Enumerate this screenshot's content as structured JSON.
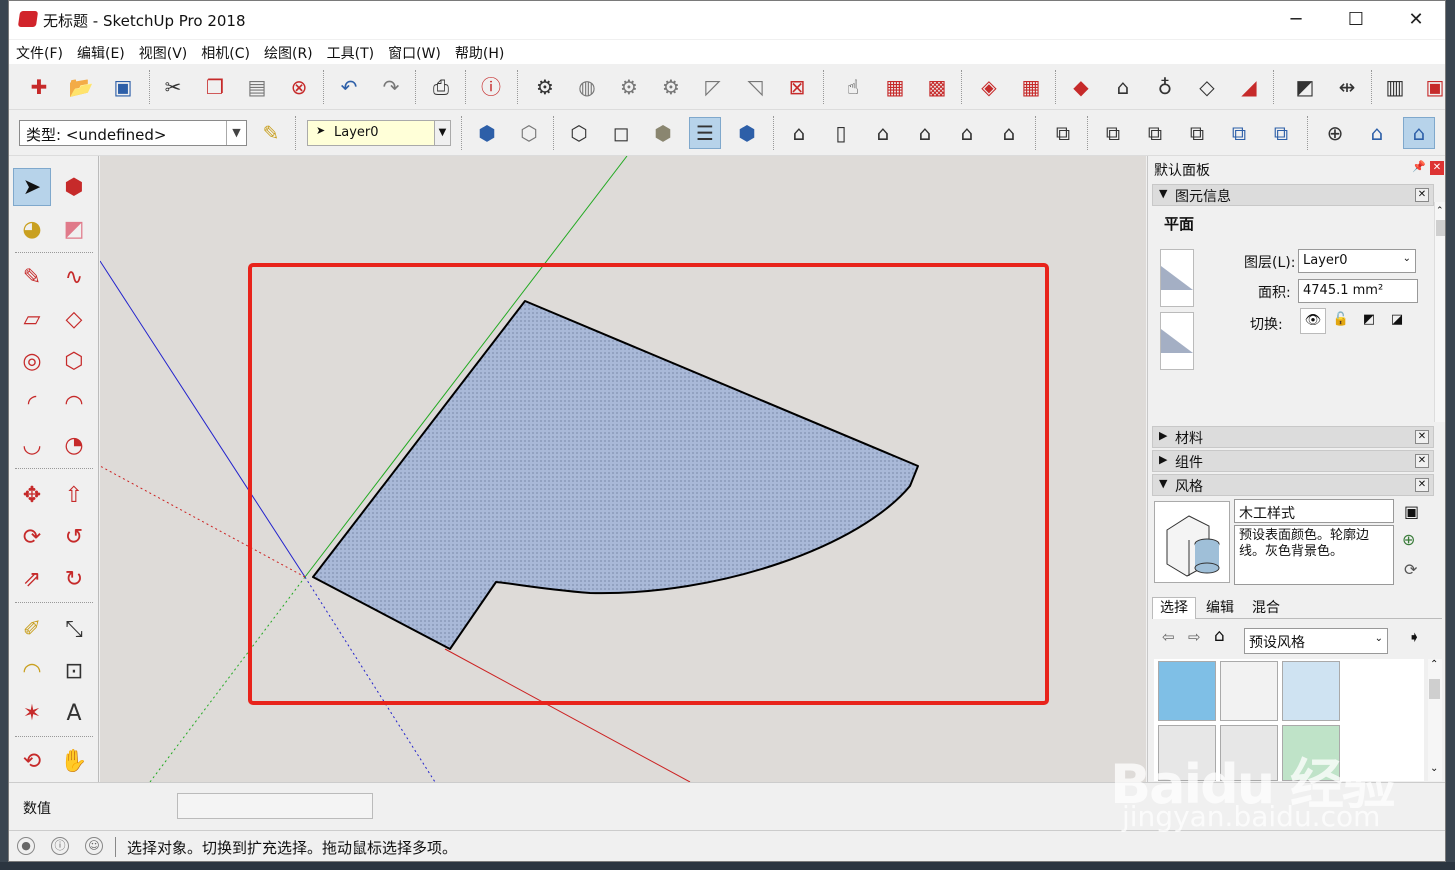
{
  "window": {
    "title": "无标题 - SketchUp Pro 2018",
    "minimize": "─",
    "maximize": "☐",
    "close": "✕"
  },
  "menu": [
    "文件(F)",
    "编辑(E)",
    "视图(V)",
    "相机(C)",
    "绘图(R)",
    "工具(T)",
    "窗口(W)",
    "帮助(H)"
  ],
  "toolbar2": {
    "type_label": "类型: <undefined>",
    "layer_value": "Layer0"
  },
  "panel": {
    "title": "默认面板",
    "entity_info": {
      "header": "图元信息",
      "entity_type": "平面",
      "layer_label": "图层(L):",
      "layer_value": "Layer0",
      "area_label": "面积:",
      "area_value": "4745.1 mm²",
      "toggle_label": "切换:"
    },
    "materials_header": "材料",
    "components_header": "组件",
    "styles": {
      "header": "风格",
      "style_name": "木工样式",
      "style_desc": "预设表面颜色。轮廓边线。灰色背景色。",
      "tabs": [
        "选择",
        "编辑",
        "混合"
      ],
      "collection": "预设风格"
    }
  },
  "measurements": {
    "label": "数值",
    "value": ""
  },
  "status": {
    "message": "选择对象。切换到扩充选择。拖动鼠标选择多项。"
  },
  "colors": {
    "face": "#a9b9d8",
    "highlight_box": "#e8231b",
    "axis_red": "#cc2222",
    "axis_green": "#22aa22",
    "axis_blue": "#2222cc",
    "active_tool": "#b7d3ea"
  },
  "watermark": {
    "brand": "Baidu 经验",
    "url": "jingyan.baidu.com"
  }
}
